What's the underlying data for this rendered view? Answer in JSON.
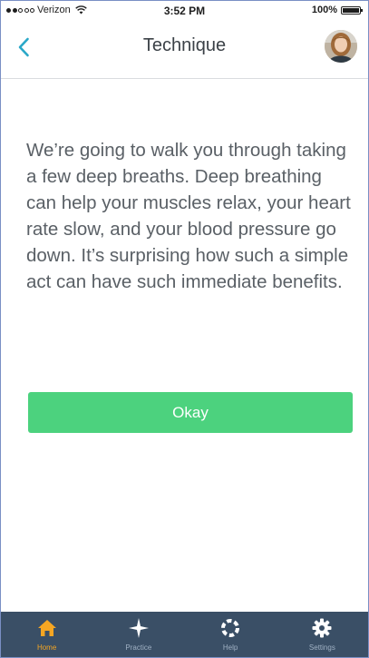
{
  "status_bar": {
    "carrier": "Verizon",
    "time": "3:52 PM",
    "battery": "100%"
  },
  "nav": {
    "title": "Technique",
    "back_icon": "chevron-left-icon",
    "avatar_icon": "user-avatar"
  },
  "main": {
    "intro": "We’re going to walk you through taking a few deep breaths. Deep breathing can help your muscles relax, your heart rate slow, and your blood pressure go down. It’s surprising how such a simple act can have such immediate benefits.",
    "okay_label": "Okay"
  },
  "tabs": [
    {
      "label": "Home",
      "icon": "home-icon",
      "active": true
    },
    {
      "label": "Practice",
      "icon": "sparkle-icon",
      "active": false
    },
    {
      "label": "Help",
      "icon": "lifebuoy-icon",
      "active": false
    },
    {
      "label": "Settings",
      "icon": "gear-icon",
      "active": false
    }
  ],
  "colors": {
    "accent": "#2aa8c8",
    "okay_button": "#4cd27e",
    "tab_bar": "#3a4f66",
    "tab_active": "#f5a623",
    "tab_inactive": "#9fb0c3"
  }
}
